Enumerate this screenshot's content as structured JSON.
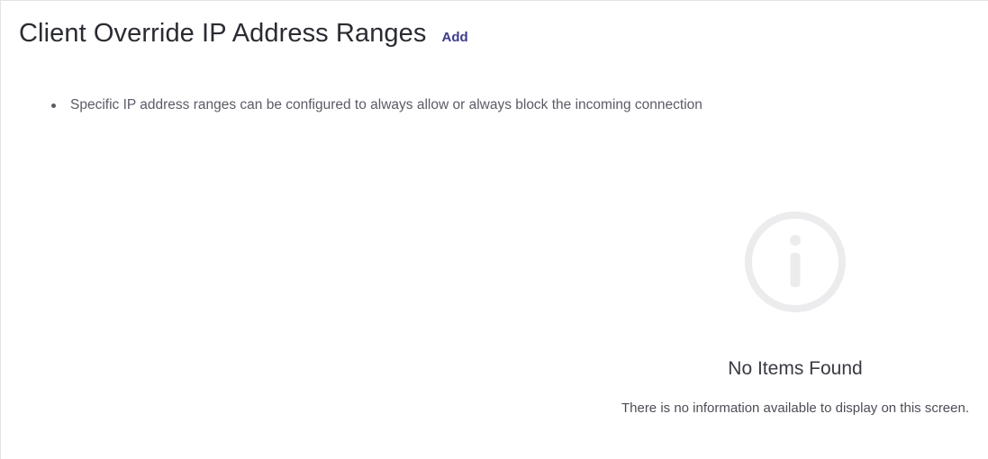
{
  "header": {
    "title": "Client Override IP Address Ranges",
    "add_label": "Add"
  },
  "notes": [
    "Specific IP address ranges can be configured to always allow or always block the incoming connection"
  ],
  "empty_state": {
    "icon": "info-circle-icon",
    "title": "No Items Found",
    "description": "There is no information available to display on this screen."
  },
  "colors": {
    "title_text": "#2b2b33",
    "link_accent": "#3d3a8c",
    "muted_text": "#5b5b66",
    "icon_gray": "#ececee"
  }
}
